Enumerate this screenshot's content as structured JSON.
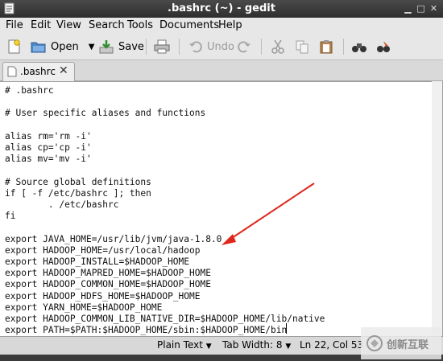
{
  "window": {
    "title": ".bashrc (~) - gedit"
  },
  "menu": [
    "File",
    "Edit",
    "View",
    "Search",
    "Tools",
    "Documents",
    "Help"
  ],
  "toolbar": {
    "open_label": "Open",
    "save_label": "Save",
    "undo_label": "Undo"
  },
  "tab": {
    "label": ".bashrc"
  },
  "editor": {
    "lines": [
      "# .bashrc",
      "",
      "# User specific aliases and functions",
      "",
      "alias rm='rm -i'",
      "alias cp='cp -i'",
      "alias mv='mv -i'",
      "",
      "# Source global definitions",
      "if [ -f /etc/bashrc ]; then",
      "        . /etc/bashrc",
      "fi",
      "",
      "export JAVA_HOME=/usr/lib/jvm/java-1.8.0",
      "export HADOOP_HOME=/usr/local/hadoop",
      "export HADOOP_INSTALL=$HADOOP_HOME",
      "export HADOOP_MAPRED_HOME=$HADOOP_HOME",
      "export HADOOP_COMMON_HOME=$HADOOP_HOME",
      "export HADOOP_HDFS_HOME=$HADOOP_HOME",
      "export YARN_HOME=$HADOOP_HOME",
      "export HADOOP_COMMON_LIB_NATIVE_DIR=$HADOOP_HOME/lib/native",
      "export PATH=$PATH:$HADOOP_HOME/sbin:$HADOOP_HOME/bin"
    ]
  },
  "status": {
    "language": "Plain Text",
    "tab_width": "Tab Width: 8",
    "position": "Ln 22, Col 53"
  },
  "watermark": {
    "text": "创新互联"
  },
  "colors": {
    "arrow": "#e0261c",
    "titlebar": "#3a3a3a"
  }
}
